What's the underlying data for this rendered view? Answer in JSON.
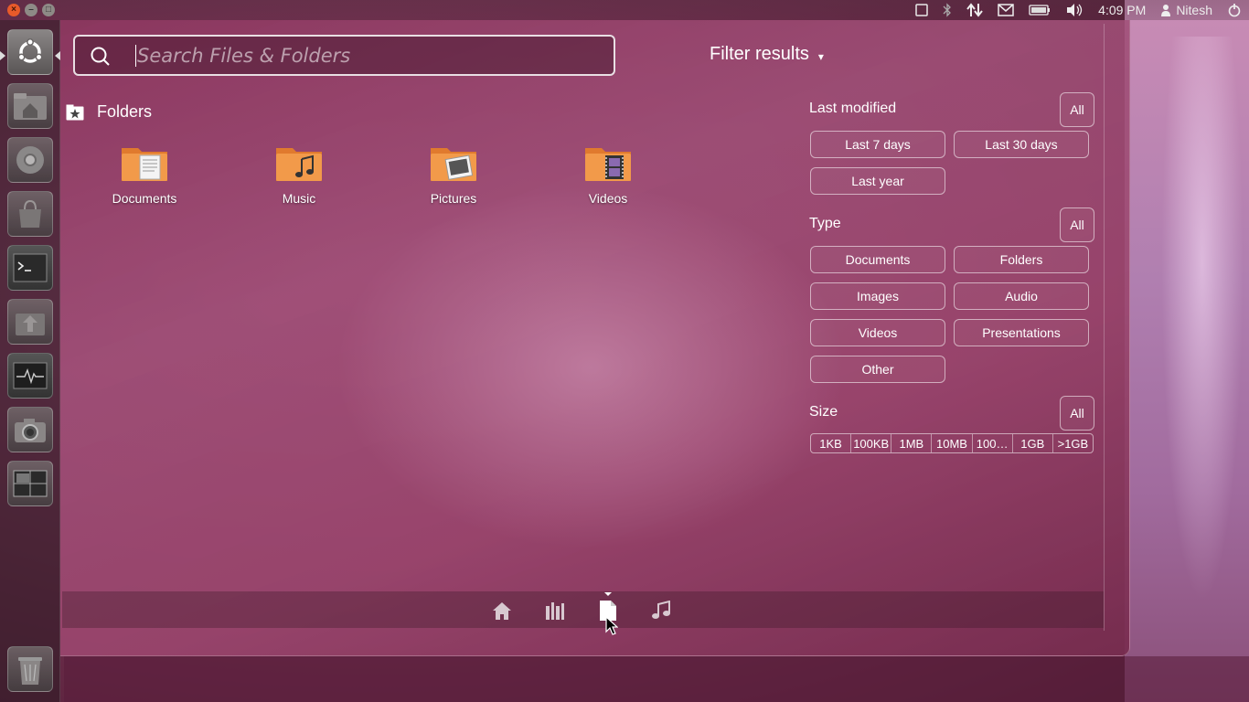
{
  "top_panel": {
    "time": "4:09 PM",
    "user": "Nitesh",
    "window_controls": [
      "close",
      "minimize",
      "maximize"
    ],
    "close_glyph": "×",
    "minimize_glyph": "–",
    "maximize_glyph": "□"
  },
  "launcher": {
    "items": [
      {
        "name": "dash-home",
        "icon": "ubuntu-logo-icon"
      },
      {
        "name": "home-folder",
        "icon": "home-folder-icon"
      },
      {
        "name": "chromium",
        "icon": "chromium-icon"
      },
      {
        "name": "software-center",
        "icon": "shopping-bag-icon"
      },
      {
        "name": "terminal",
        "icon": "terminal-icon"
      },
      {
        "name": "update-manager",
        "icon": "update-icon"
      },
      {
        "name": "system-monitor",
        "icon": "system-monitor-icon"
      },
      {
        "name": "camera",
        "icon": "camera-icon"
      },
      {
        "name": "workspace-switcher",
        "icon": "workspace-switcher-icon"
      },
      {
        "name": "trash",
        "icon": "trash-icon"
      }
    ]
  },
  "search": {
    "placeholder": "Search Files & Folders"
  },
  "filter_toggle": {
    "label": "Filter results",
    "arrow": "▾"
  },
  "folders_section": {
    "title": "Folders",
    "items": [
      {
        "label": "Documents",
        "emblem": "document"
      },
      {
        "label": "Music",
        "emblem": "music-note"
      },
      {
        "label": "Pictures",
        "emblem": "picture"
      },
      {
        "label": "Videos",
        "emblem": "film"
      }
    ]
  },
  "filters": {
    "last_modified": {
      "label": "Last modified",
      "all": "All",
      "options": [
        "Last 7 days",
        "Last 30 days",
        "Last year"
      ]
    },
    "type": {
      "label": "Type",
      "all": "All",
      "options": [
        "Documents",
        "Folders",
        "Images",
        "Audio",
        "Videos",
        "Presentations",
        "Other"
      ]
    },
    "size": {
      "label": "Size",
      "all": "All",
      "options": [
        "1KB",
        "100KB",
        "1MB",
        "10MB",
        "100…",
        "1GB",
        ">1GB"
      ]
    }
  },
  "lens_bar": {
    "lenses": [
      "home-lens-icon",
      "applications-lens-icon",
      "files-lens-icon",
      "music-lens-icon"
    ],
    "active": "files-lens-icon"
  },
  "colors": {
    "accent_close": "#e85a2a",
    "dash_tint": "#8c375f"
  }
}
